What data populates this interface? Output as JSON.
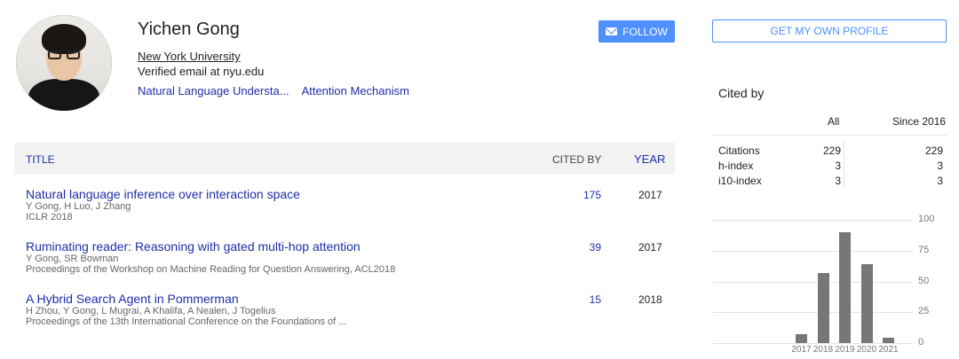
{
  "profile": {
    "name": "Yichen Gong",
    "affiliation": "New York University",
    "email": "Verified email at nyu.edu",
    "interests": [
      "Natural Language Understa...",
      "Attention Mechanism"
    ],
    "follow_label": "FOLLOW"
  },
  "table": {
    "headers": {
      "title": "TITLE",
      "cited_by": "CITED BY",
      "year": "YEAR"
    },
    "rows": [
      {
        "title": "Natural language inference over interaction space",
        "authors": "Y Gong, H Luo, J Zhang",
        "venue": "ICLR 2018",
        "cited_by": "175",
        "year": "2017"
      },
      {
        "title": "Ruminating reader: Reasoning with gated multi-hop attention",
        "authors": "Y Gong, SR Bowman",
        "venue": "Proceedings of the Workshop on Machine Reading for Question Answering, ACL2018",
        "cited_by": "39",
        "year": "2017"
      },
      {
        "title": "A Hybrid Search Agent in Pommerman",
        "authors": "H Zhou, Y Gong, L Mugrai, A Khalifa, A Nealen, J Togelius",
        "venue": "Proceedings of the 13th International Conference on the Foundations of ...",
        "cited_by": "15",
        "year": "2018"
      }
    ]
  },
  "sidebar": {
    "own_profile_label": "GET MY OWN PROFILE",
    "cited_by_title": "Cited by",
    "col_all": "All",
    "col_since": "Since 2016",
    "stats": [
      {
        "label": "Citations",
        "all": "229",
        "since": "229"
      },
      {
        "label": "h-index",
        "all": "3",
        "since": "3"
      },
      {
        "label": "i10-index",
        "all": "3",
        "since": "3"
      }
    ]
  },
  "chart_data": {
    "type": "bar",
    "categories": [
      "2017",
      "2018",
      "2019",
      "2020",
      "2021"
    ],
    "values": [
      7,
      57,
      90,
      64,
      4
    ],
    "ylim": [
      0,
      100
    ],
    "yticks": [
      "100",
      "75",
      "50",
      "25",
      "0"
    ],
    "bar_color": "#777777"
  },
  "colors": {
    "link": "#1e2ea8",
    "accent": "#4d90fe",
    "header_bg": "#f2f2f2"
  }
}
